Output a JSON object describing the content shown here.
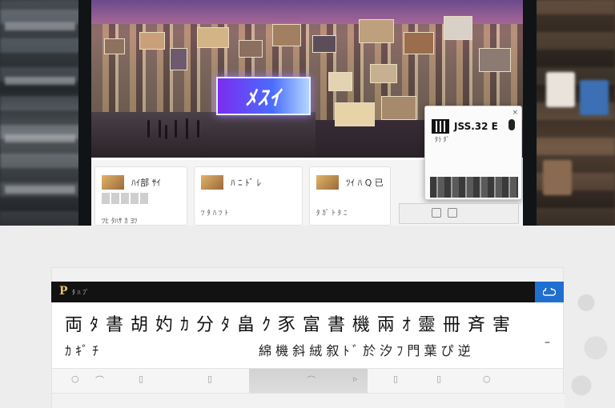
{
  "hero": {
    "sign_text": "ﾒｽｲ",
    "badge_left": "",
    "badge_right": ""
  },
  "cards": [
    {
      "title": "ﾊｲ部 ｻｲ",
      "subtitle": "ﾂﾋ ﾀﾊｻ ｶ ﾖﾂ"
    },
    {
      "title": "ﾊ ﾆ ﾄﾞ ﾚ",
      "subtitle": "ﾂ ﾀ ﾊ ﾂ ﾄ"
    },
    {
      "title": "ﾂｲ ﾊ Q 已",
      "subtitle": "ﾀ ｶﾞ ﾄ ﾀ ﾆ"
    }
  ],
  "popup": {
    "title": "JSS.32 E",
    "subtitle": "ﾀﾗ ﾀﾞ",
    "close": "×"
  },
  "toolbar": {
    "logo": "P",
    "title": "ﾀ ﾊ ﾌﾞ",
    "action_icon": "cloud-icon"
  },
  "content": {
    "headline": "両 ﾀ 書 胡 妁 ｶ 分 ﾀ 畠 ｸ 豕 富 書 機 兩 ｵ 靈 冊 斉 害",
    "subline_left": "ｶ ｷﾞ ﾁ",
    "subline_right": "綿 機 斜 絨 叙 ﾄ ﾞ 於 汐 ﾌ 門 葉 ぴ 逆",
    "dash": "–"
  },
  "colors": {
    "toolbar_bg": "#121212",
    "accent_blue": "#1f6fd1",
    "logo_gold": "#e8c26a"
  }
}
